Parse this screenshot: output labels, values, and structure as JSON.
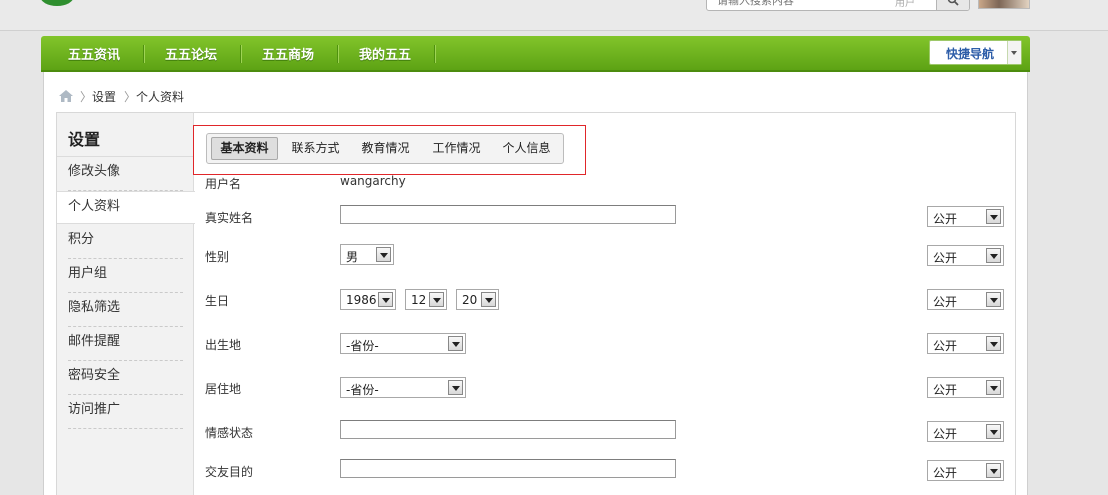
{
  "header": {
    "search": {
      "placeholder": "请输入搜索内容",
      "scope": "用户"
    }
  },
  "nav": {
    "items": [
      "五五资讯",
      "五五论坛",
      "五五商场",
      "我的五五"
    ],
    "quick_nav": "快捷导航"
  },
  "breadcrumb": {
    "items": [
      "设置",
      "个人资料"
    ]
  },
  "sidebar": {
    "title": "设置",
    "items": [
      "修改头像",
      "个人资料",
      "积分",
      "用户组",
      "隐私筛选",
      "邮件提醒",
      "密码安全",
      "访问推广"
    ],
    "active": "个人资料"
  },
  "tabs": {
    "items": [
      "基本资料",
      "联系方式",
      "教育情况",
      "工作情况",
      "个人信息"
    ],
    "active": "基本资料"
  },
  "form": {
    "username": {
      "label": "用户名",
      "value": "wangarchy"
    },
    "realname": {
      "label": "真实姓名",
      "value": "",
      "privacy": "公开"
    },
    "gender": {
      "label": "性别",
      "value": "男",
      "privacy": "公开"
    },
    "birthday": {
      "label": "生日",
      "year": "1986",
      "month": "12",
      "day": "20",
      "privacy": "公开"
    },
    "birthplace": {
      "label": "出生地",
      "value": "-省份-",
      "privacy": "公开"
    },
    "residence": {
      "label": "居住地",
      "value": "-省份-",
      "privacy": "公开"
    },
    "affective": {
      "label": "情感状态",
      "value": "",
      "privacy": "公开"
    },
    "lookingfor": {
      "label": "交友目的",
      "value": "",
      "privacy": "公开"
    }
  }
}
